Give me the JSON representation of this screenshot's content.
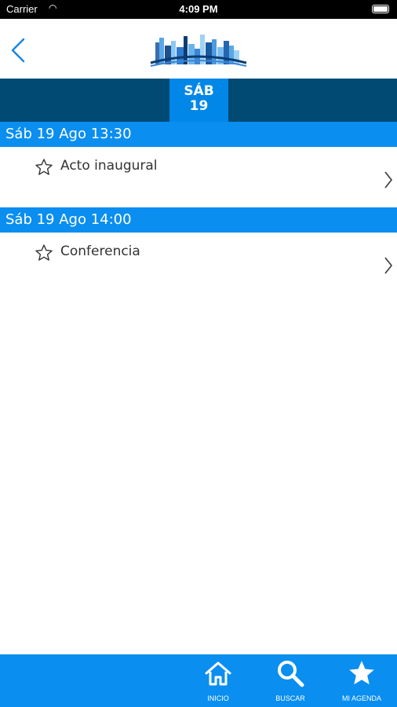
{
  "status_bar": {
    "carrier": "Carrier",
    "time": "4:09 PM"
  },
  "nav": {
    "back_icon": "chevron-left-icon",
    "logo": "city-skyline-logo"
  },
  "day_tabs": [
    {
      "weekday": "SÁB",
      "day": "19"
    }
  ],
  "sections": [
    {
      "header": "Sáb 19 Ago 13:30",
      "events": [
        {
          "title": "Acto inaugural",
          "favorite_icon": "star-outline-icon"
        }
      ]
    },
    {
      "header": "Sáb 19 Ago 14:00",
      "events": [
        {
          "title": "Conferencia",
          "favorite_icon": "star-outline-icon"
        }
      ]
    }
  ],
  "tab_bar": {
    "items": [
      {
        "label": "INICIO",
        "icon": "home-icon"
      },
      {
        "label": "BUSCAR",
        "icon": "search-icon"
      },
      {
        "label": "MI AGENDA",
        "icon": "star-icon"
      }
    ]
  },
  "colors": {
    "accent": "#0a8ef0",
    "day_strip": "#004a73",
    "selected_day": "#0087e8",
    "text": "#333333"
  }
}
